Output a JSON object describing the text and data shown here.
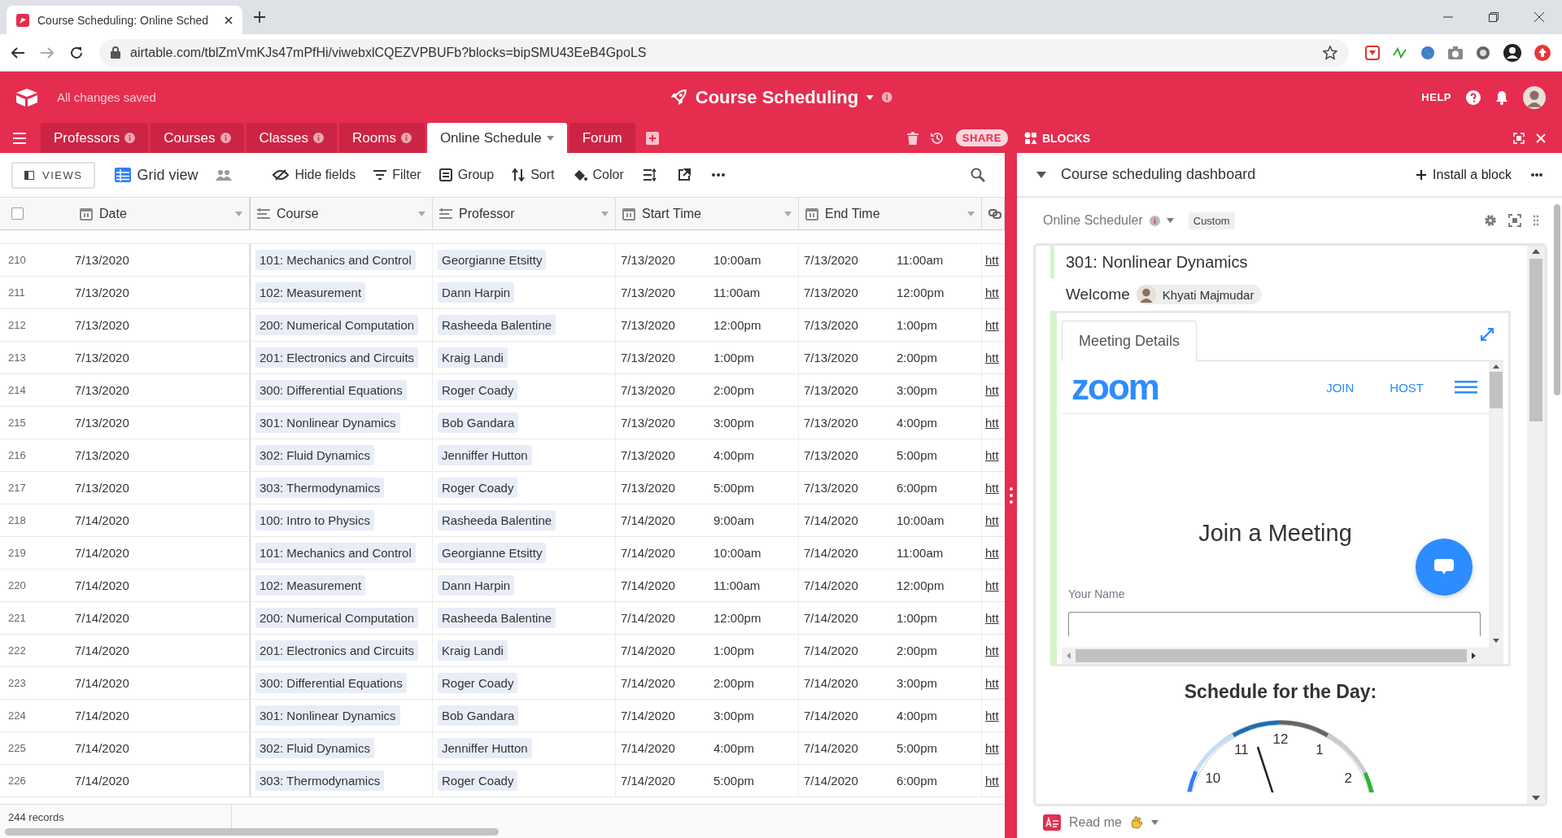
{
  "browser": {
    "tab_title": "Course Scheduling: Online Sched",
    "url": "airtable.com/tblZmVmKJs47mPfHi/viwebxlCQEZVPBUFb?blocks=bipSMU43EeB4GpoLS"
  },
  "header": {
    "status": "All changes saved",
    "base_name": "Course Scheduling",
    "help": "HELP"
  },
  "tables": [
    {
      "label": "Professors",
      "selected": false
    },
    {
      "label": "Courses",
      "selected": false
    },
    {
      "label": "Classes",
      "selected": false
    },
    {
      "label": "Rooms",
      "selected": false
    },
    {
      "label": "Online Schedule",
      "selected": true
    },
    {
      "label": "Forum",
      "selected": false
    }
  ],
  "header_actions": {
    "share": "SHARE",
    "blocks": "BLOCKS"
  },
  "toolbar": {
    "views": "VIEWS",
    "view_name": "Grid view",
    "items": [
      {
        "kind": "hide",
        "label": "Hide fields"
      },
      {
        "kind": "filter",
        "label": "Filter"
      },
      {
        "kind": "group",
        "label": "Group"
      },
      {
        "kind": "sort",
        "label": "Sort"
      },
      {
        "kind": "color",
        "label": "Color"
      }
    ]
  },
  "grid": {
    "select_all": {
      "checked": false
    },
    "columns": [
      {
        "kind": "date",
        "label": "Date"
      },
      {
        "kind": "text",
        "label": "Course"
      },
      {
        "kind": "text",
        "label": "Professor"
      },
      {
        "kind": "date",
        "label": "Start Time"
      },
      {
        "kind": "date",
        "label": "End Time"
      },
      {
        "kind": "link"
      }
    ],
    "rows": [
      {
        "n": "210",
        "date": "7/13/2020",
        "course": "101: Mechanics and Control",
        "professor": "Georgianne Etsitty",
        "start_date": "7/13/2020",
        "start_time": "10:00am",
        "end_date": "7/13/2020",
        "end_time": "11:00am",
        "link": "htt"
      },
      {
        "n": "211",
        "date": "7/13/2020",
        "course": "102: Measurement",
        "professor": "Dann Harpin",
        "start_date": "7/13/2020",
        "start_time": "11:00am",
        "end_date": "7/13/2020",
        "end_time": "12:00pm",
        "link": "htt"
      },
      {
        "n": "212",
        "date": "7/13/2020",
        "course": "200: Numerical Computation",
        "professor": "Rasheeda Balentine",
        "start_date": "7/13/2020",
        "start_time": "12:00pm",
        "end_date": "7/13/2020",
        "end_time": "1:00pm",
        "link": "htt"
      },
      {
        "n": "213",
        "date": "7/13/2020",
        "course": "201: Electronics and Circuits",
        "professor": "Kraig Landi",
        "start_date": "7/13/2020",
        "start_time": "1:00pm",
        "end_date": "7/13/2020",
        "end_time": "2:00pm",
        "link": "htt"
      },
      {
        "n": "214",
        "date": "7/13/2020",
        "course": "300: Differential Equations",
        "professor": "Roger Coady",
        "start_date": "7/13/2020",
        "start_time": "2:00pm",
        "end_date": "7/13/2020",
        "end_time": "3:00pm",
        "link": "htt"
      },
      {
        "n": "215",
        "date": "7/13/2020",
        "course": "301: Nonlinear Dynamics",
        "professor": "Bob Gandara",
        "start_date": "7/13/2020",
        "start_time": "3:00pm",
        "end_date": "7/13/2020",
        "end_time": "4:00pm",
        "link": "htt"
      },
      {
        "n": "216",
        "date": "7/13/2020",
        "course": "302: Fluid Dynamics",
        "professor": "Jenniffer Hutton",
        "start_date": "7/13/2020",
        "start_time": "4:00pm",
        "end_date": "7/13/2020",
        "end_time": "5:00pm",
        "link": "htt"
      },
      {
        "n": "217",
        "date": "7/13/2020",
        "course": "303: Thermodynamics",
        "professor": "Roger Coady",
        "start_date": "7/13/2020",
        "start_time": "5:00pm",
        "end_date": "7/13/2020",
        "end_time": "6:00pm",
        "link": "htt"
      },
      {
        "n": "218",
        "date": "7/14/2020",
        "course": "100: Intro to Physics",
        "professor": "Rasheeda Balentine",
        "start_date": "7/14/2020",
        "start_time": "9:00am",
        "end_date": "7/14/2020",
        "end_time": "10:00am",
        "link": "htt"
      },
      {
        "n": "219",
        "date": "7/14/2020",
        "course": "101: Mechanics and Control",
        "professor": "Georgianne Etsitty",
        "start_date": "7/14/2020",
        "start_time": "10:00am",
        "end_date": "7/14/2020",
        "end_time": "11:00am",
        "link": "htt"
      },
      {
        "n": "220",
        "date": "7/14/2020",
        "course": "102: Measurement",
        "professor": "Dann Harpin",
        "start_date": "7/14/2020",
        "start_time": "11:00am",
        "end_date": "7/14/2020",
        "end_time": "12:00pm",
        "link": "htt"
      },
      {
        "n": "221",
        "date": "7/14/2020",
        "course": "200: Numerical Computation",
        "professor": "Rasheeda Balentine",
        "start_date": "7/14/2020",
        "start_time": "12:00pm",
        "end_date": "7/14/2020",
        "end_time": "1:00pm",
        "link": "htt"
      },
      {
        "n": "222",
        "date": "7/14/2020",
        "course": "201: Electronics and Circuits",
        "professor": "Kraig Landi",
        "start_date": "7/14/2020",
        "start_time": "1:00pm",
        "end_date": "7/14/2020",
        "end_time": "2:00pm",
        "link": "htt"
      },
      {
        "n": "223",
        "date": "7/14/2020",
        "course": "300: Differential Equations",
        "professor": "Roger Coady",
        "start_date": "7/14/2020",
        "start_time": "2:00pm",
        "end_date": "7/14/2020",
        "end_time": "3:00pm",
        "link": "htt"
      },
      {
        "n": "224",
        "date": "7/14/2020",
        "course": "301: Nonlinear Dynamics",
        "professor": "Bob Gandara",
        "start_date": "7/14/2020",
        "start_time": "3:00pm",
        "end_date": "7/14/2020",
        "end_time": "4:00pm",
        "link": "htt"
      },
      {
        "n": "225",
        "date": "7/14/2020",
        "course": "302: Fluid Dynamics",
        "professor": "Jenniffer Hutton",
        "start_date": "7/14/2020",
        "start_time": "4:00pm",
        "end_date": "7/14/2020",
        "end_time": "5:00pm",
        "link": "htt"
      },
      {
        "n": "226",
        "date": "7/14/2020",
        "course": "303: Thermodynamics",
        "professor": "Roger Coady",
        "start_date": "7/14/2020",
        "start_time": "5:00pm",
        "end_date": "7/14/2020",
        "end_time": "6:00pm",
        "link": "htt"
      }
    ],
    "footer": "244 records"
  },
  "dashboard": {
    "title": "Course scheduling dashboard",
    "install": "Install a block",
    "block_name": "Online Scheduler",
    "block_tag": "Custom",
    "course": "301: Nonlinear Dynamics",
    "welcome": "Welcome",
    "user": "Khyati Majmudar",
    "tab": "Meeting Details",
    "logo": "zoom",
    "nav": [
      "JOIN",
      "HOST"
    ],
    "join_heading": "Join a Meeting",
    "name_label": "Your Name",
    "schedule_title": "Schedule for the Day:",
    "clock_labels": [
      "10",
      "11",
      "12",
      "1",
      "2"
    ],
    "next_block": "Read me"
  }
}
